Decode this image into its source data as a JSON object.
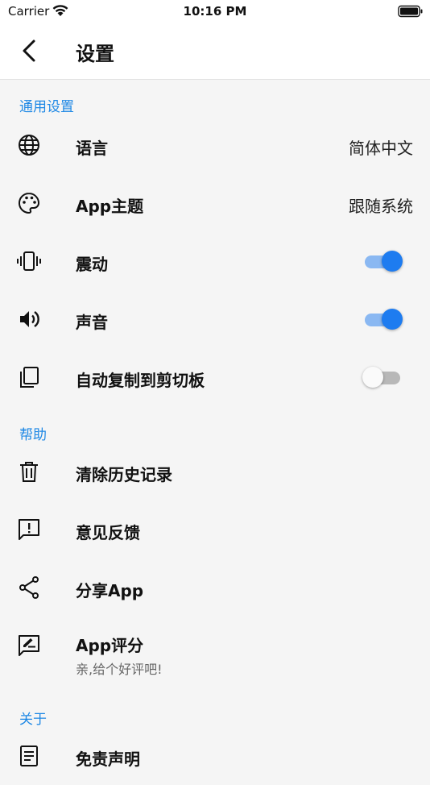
{
  "status_bar": {
    "carrier": "Carrier",
    "time": "10:16 PM"
  },
  "app_bar": {
    "title": "设置",
    "back_icon": "chevron-left-icon"
  },
  "sections": {
    "general": {
      "header": "通用设置",
      "language": {
        "label": "语言",
        "value": "简体中文",
        "icon": "globe-icon"
      },
      "theme": {
        "label": "App主题",
        "value": "跟随系统",
        "icon": "palette-icon"
      },
      "vibration": {
        "label": "震动",
        "enabled": true,
        "icon": "vibrate-icon"
      },
      "sound": {
        "label": "声音",
        "enabled": true,
        "icon": "speaker-icon"
      },
      "auto_copy": {
        "label": "自动复制到剪切板",
        "enabled": false,
        "icon": "copy-icon"
      }
    },
    "help": {
      "header": "帮助",
      "clear_history": {
        "label": "清除历史记录",
        "icon": "trash-icon"
      },
      "feedback": {
        "label": "意见反馈",
        "icon": "feedback-icon"
      },
      "share": {
        "label": "分享App",
        "icon": "share-icon"
      },
      "rate": {
        "label": "App评分",
        "subtitle": "亲,给个好评吧!",
        "icon": "rate-review-icon"
      }
    },
    "about": {
      "header": "关于",
      "disclaimer": {
        "label": "免责声明",
        "icon": "document-icon"
      }
    }
  },
  "colors": {
    "accent": "#1e88e5",
    "switch_on": "#1e7cf0",
    "switch_track_on": "#8ab8f2",
    "switch_track_off": "#b8b8b8"
  }
}
